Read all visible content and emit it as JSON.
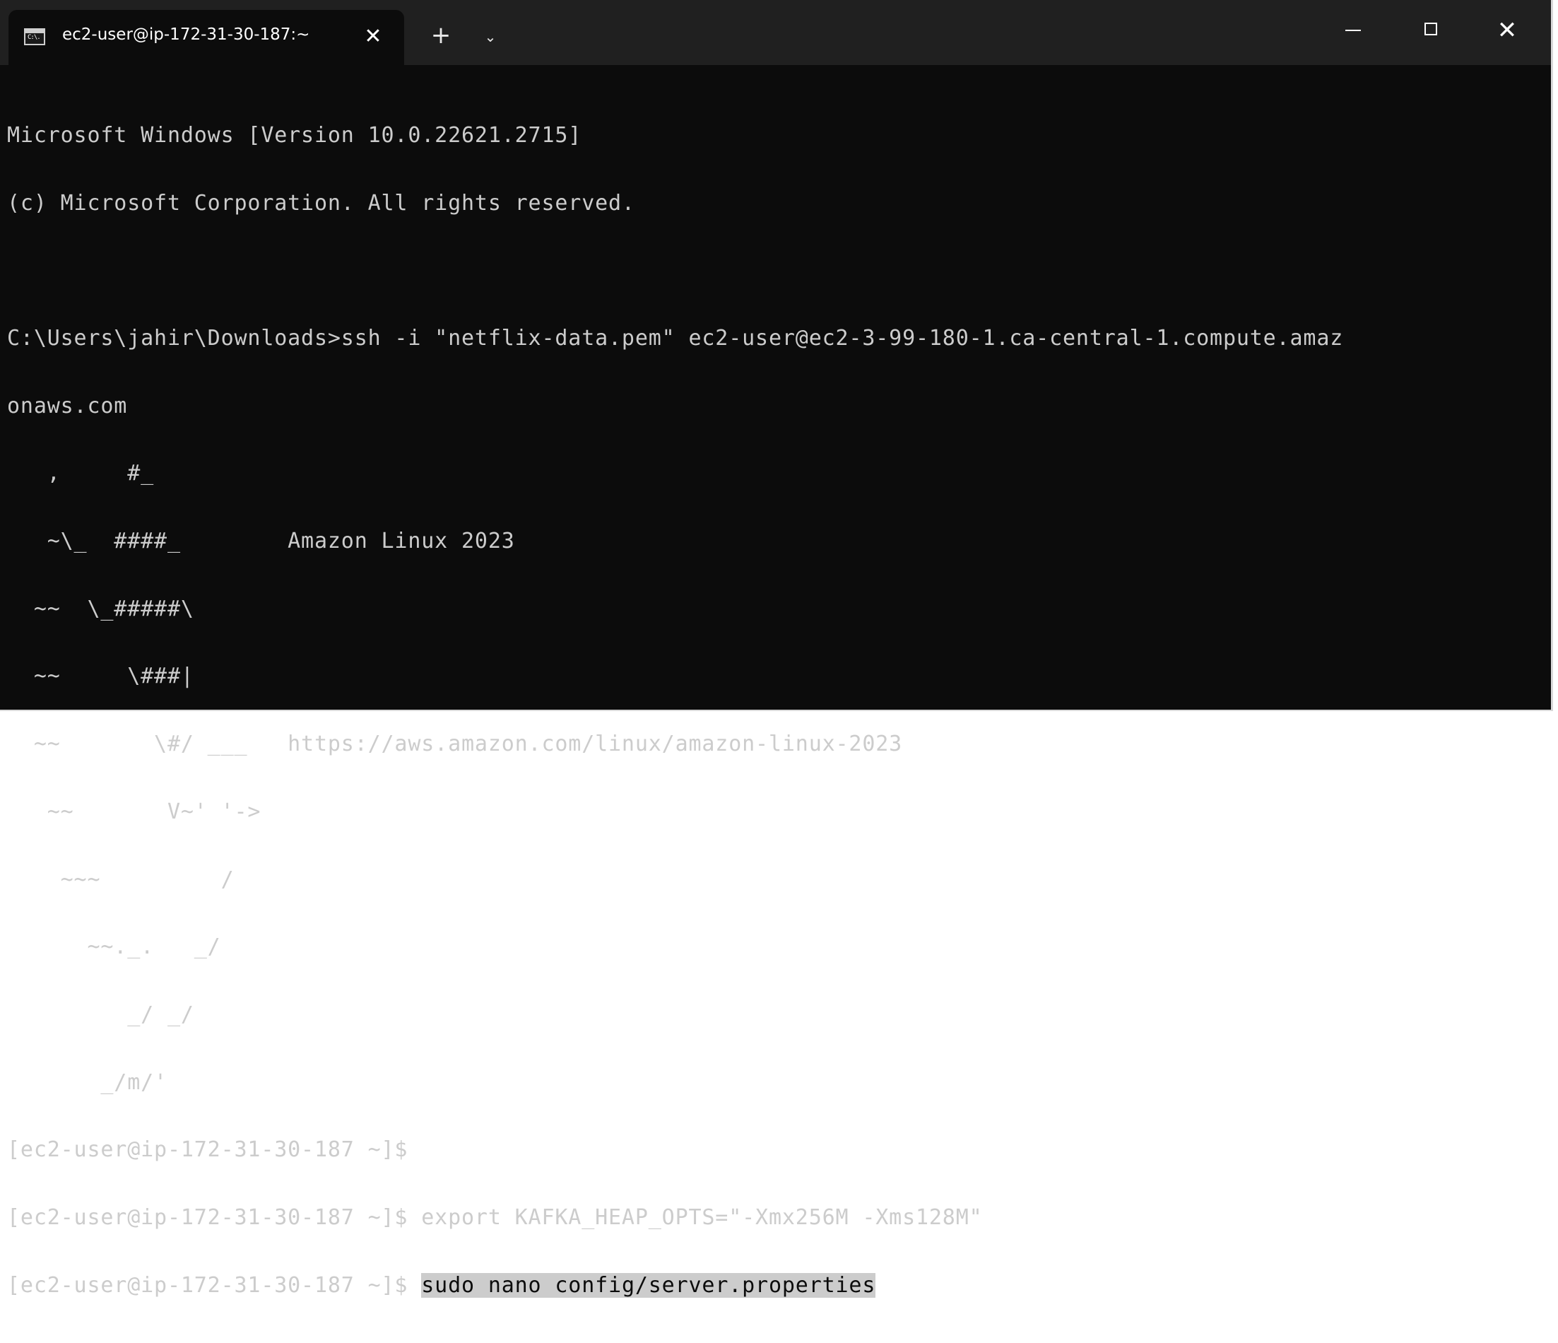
{
  "tab": {
    "icon": "terminal-icon",
    "icon_glyph": "C:\\.",
    "title": "ec2-user@ip-172-31-30-187:~",
    "close_glyph": "✕"
  },
  "toolbar": {
    "new_tab_glyph": "+",
    "dropdown_glyph": "⌄"
  },
  "window_controls": {
    "close_glyph": "✕"
  },
  "colors": {
    "background": "#0c0c0c",
    "titlebar": "#202020",
    "text": "#cccccc",
    "selection": "#cccccc"
  },
  "terminal": {
    "lines": [
      "Microsoft Windows [Version 10.0.22621.2715]",
      "(c) Microsoft Corporation. All rights reserved.",
      "",
      "C:\\Users\\jahir\\Downloads>ssh -i \"netflix-data.pem\" ec2-user@ec2-3-99-180-1.ca-central-1.compute.amaz",
      "onaws.com",
      "   ,     #_",
      "   ~\\_  ####_        Amazon Linux 2023",
      "  ~~  \\_#####\\",
      "  ~~     \\###|",
      "  ~~       \\#/ ___   https://aws.amazon.com/linux/amazon-linux-2023",
      "   ~~       V~' '->",
      "    ~~~         /",
      "      ~~._.   _/",
      "         _/ _/",
      "       _/m/'",
      "[ec2-user@ip-172-31-30-187 ~]$",
      "[ec2-user@ip-172-31-30-187 ~]$ export KAFKA_HEAP_OPTS=\"-Xmx256M -Xms128M\""
    ],
    "current_prompt": "[ec2-user@ip-172-31-30-187 ~]$ ",
    "current_command": "sudo nano config/server.properties"
  }
}
